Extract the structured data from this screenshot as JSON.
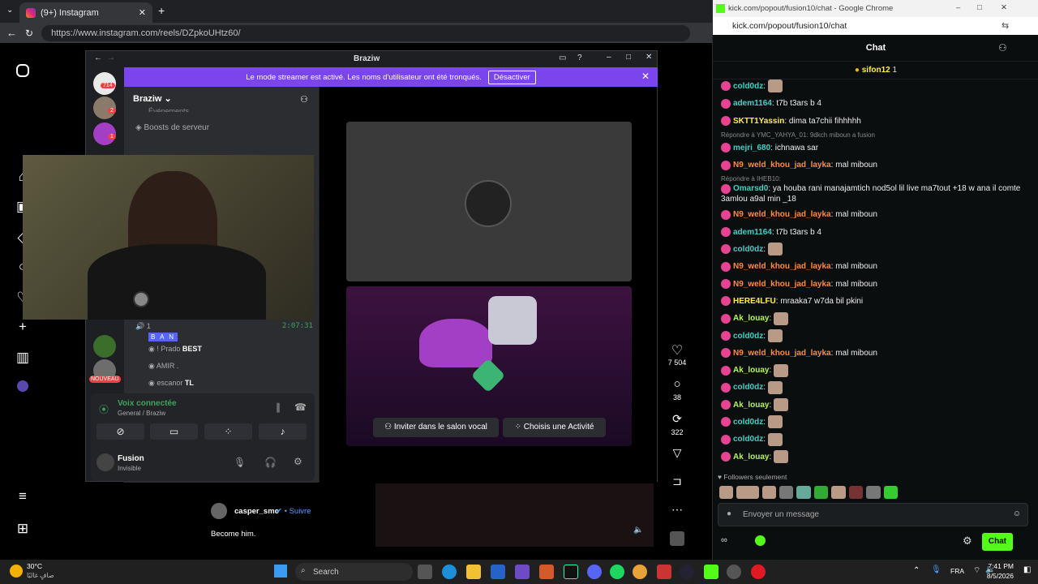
{
  "browser": {
    "tab_title": "(9+) Instagram",
    "url": "https://www.instagram.com/reels/DZpkoUHtz60/"
  },
  "discord": {
    "window_title": "Braziw",
    "banner_text": "Le mode streamer est activé. Les noms d'utilisateur ont été tronqués.",
    "banner_button": "Désactiver",
    "server_badges": [
      "714",
      "2",
      "1"
    ],
    "server_name": "Braziw",
    "channel_partial": "Événements",
    "boosts": "Boosts de serveur",
    "voice_timer": "2:07:31",
    "voice_count": "1",
    "ban_tag": "B A N",
    "members": [
      {
        "name": "! Prado",
        "tag": "BEST"
      },
      {
        "name": "AMIR .",
        "tag": ""
      },
      {
        "name": "escanor",
        "tag": "TL"
      }
    ],
    "server_new_badge": "NOUVEAU",
    "voice_status": "Voix connectée",
    "voice_channel": "General / Braziw",
    "user_name": "Fusion",
    "user_status": "Invisible",
    "invite_button": "Inviter dans le salon vocal",
    "activity_button": "Choisis une Activité"
  },
  "reel": {
    "likes": "7 504",
    "comments": "38",
    "reposts": "322",
    "author": "casper_smc",
    "follow": "Suivre",
    "caption": "Become him."
  },
  "kick": {
    "window_title": "kick.com/popout/fusion10/chat - Google Chrome",
    "url": "kick.com/popout/fusion10/chat",
    "header": "Chat",
    "pinned_user": "sifon12",
    "pinned_count": "1",
    "messages": [
      {
        "user": "cold0dz",
        "text": "",
        "color": "#3fd0c6",
        "emote": true
      },
      {
        "user": "adem1164",
        "text": "t7b t3ars b 4",
        "color": "#3fd0c6"
      },
      {
        "user": "SKTT1Yassin",
        "text": "dima ta7chii fihhhhh",
        "color": "#fff03b"
      },
      {
        "reply": "Répondre à YMC_YAHYA_01: 9dkch miboun a fusion",
        "user": "mejri_680",
        "text": "ichnawa sar",
        "color": "#3fd0c6"
      },
      {
        "user": "N9_weld_khou_jad_layka",
        "text": "mal miboun",
        "color": "#ff8a3b"
      },
      {
        "reply": "Répondre à IHEB10:",
        "user": "Omarsd0",
        "text": "ya houba rani manajamtich nod5ol lil live ma7tout +18 w ana il comte 3amlou a9al min _18",
        "color": "#3fd0c6",
        "tall": true
      },
      {
        "user": "N9_weld_khou_jad_layka",
        "text": "mal miboun",
        "color": "#ff8a3b"
      },
      {
        "user": "adem1164",
        "text": "t7b t3ars b 4",
        "color": "#3fd0c6"
      },
      {
        "user": "cold0dz",
        "text": "",
        "color": "#3fd0c6",
        "emote": true
      },
      {
        "user": "N9_weld_khou_jad_layka",
        "text": "mal miboun",
        "color": "#ff8a3b"
      },
      {
        "user": "N9_weld_khou_jad_layka",
        "text": "mal miboun",
        "color": "#ff8a3b"
      },
      {
        "user": "HERE4LFU",
        "text": "mraaka7 w7da bil pkini",
        "color": "#fff03b"
      },
      {
        "user": "Ak_louay",
        "text": "",
        "color": "#b5f35a",
        "emote": true
      },
      {
        "user": "cold0dz",
        "text": "",
        "color": "#3fd0c6",
        "emote": true
      },
      {
        "user": "N9_weld_khou_jad_layka",
        "text": "mal miboun",
        "color": "#ff8a3b"
      },
      {
        "user": "Ak_louay",
        "text": "",
        "color": "#b5f35a",
        "emote": true
      },
      {
        "user": "cold0dz",
        "text": "",
        "color": "#3fd0c6",
        "emote": true
      },
      {
        "user": "Ak_louay",
        "text": "",
        "color": "#b5f35a",
        "emote": true
      },
      {
        "user": "cold0dz",
        "text": "",
        "color": "#3fd0c6",
        "emote": true
      },
      {
        "user": "cold0dz",
        "text": "",
        "color": "#3fd0c6",
        "emote": true
      },
      {
        "user": "Ak_louay",
        "text": "",
        "color": "#b5f35a",
        "emote": true
      }
    ],
    "followers_only": "Followers seulement",
    "input_placeholder": "Envoyer un message",
    "chat_button": "Chat"
  },
  "taskbar": {
    "weather_temp": "30°C",
    "weather_text": "صافٍ غالبًا",
    "search": "Search",
    "lang": "FRA",
    "time": "7:41 PM",
    "date": "8/5/2026"
  }
}
